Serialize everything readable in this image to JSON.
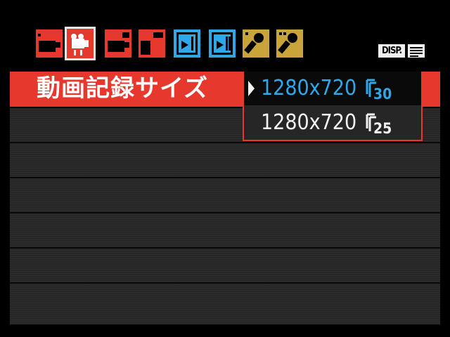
{
  "tabs": [
    {
      "icon": "shooting-camera-icon",
      "color": "#e6382c",
      "active": false
    },
    {
      "icon": "movie-camera-icon",
      "color": "#e6382c",
      "active": true
    },
    {
      "icon": "shooting-camera-icon",
      "color": "#e6382c",
      "active": false
    },
    {
      "icon": "camera-icon",
      "color": "#e6382c",
      "active": false
    },
    {
      "icon": "playback-icon",
      "color": "#2ea8e8",
      "active": false
    },
    {
      "icon": "playback-icon",
      "color": "#2ea8e8",
      "active": false
    },
    {
      "icon": "wrench-icon",
      "color": "#c8a43a",
      "active": false
    },
    {
      "icon": "wrench-icon",
      "color": "#c8a43a",
      "active": false
    }
  ],
  "disp_button": "DISP.",
  "menu": {
    "selected_item": "動画記録サイズ"
  },
  "dropdown": {
    "options": [
      {
        "label": "1280x720",
        "frame_rate": "30",
        "selected": true
      },
      {
        "label": "1280x720",
        "frame_rate": "25",
        "selected": false
      }
    ]
  },
  "colors": {
    "accent_red": "#e6382c",
    "playback_blue": "#2ea8e8",
    "setup_yellow": "#c8a43a",
    "panel_gray": "#262626"
  }
}
